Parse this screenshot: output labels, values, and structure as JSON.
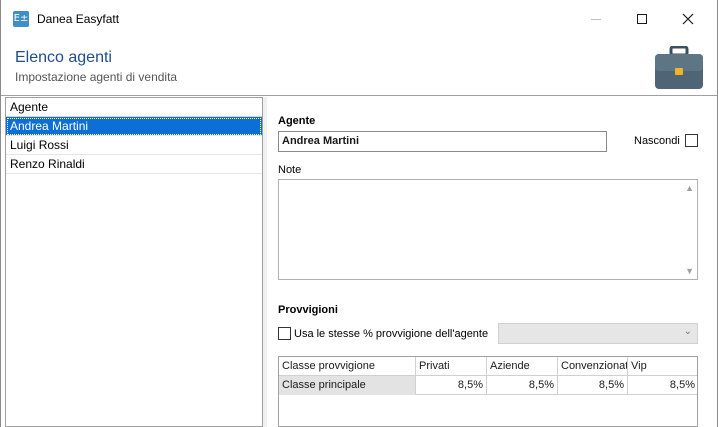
{
  "window": {
    "app_icon_text": "E±",
    "title": "Danea Easyfatt"
  },
  "header": {
    "title": "Elenco agenti",
    "subtitle": "Impostazione agenti di vendita",
    "icon": "briefcase-icon"
  },
  "agent_list": {
    "column_header": "Agente",
    "items": [
      {
        "label": "Andrea Martini",
        "selected": true
      },
      {
        "label": "Luigi Rossi",
        "selected": false
      },
      {
        "label": "Renzo Rinaldi",
        "selected": false
      }
    ]
  },
  "form": {
    "agent_label": "Agente",
    "agent_value": "Andrea Martini",
    "hide_label": "Nascondi",
    "hide_checked": false,
    "notes_label": "Note",
    "notes_value": "",
    "commissions_label": "Provvigioni",
    "same_commission_label": "Usa le stesse % provvigione dell'agente",
    "same_commission_checked": false,
    "same_commission_agent": ""
  },
  "commission_grid": {
    "columns": [
      "Classe provvigione",
      "Privati",
      "Aziende",
      "Convenzionati",
      "Vip"
    ],
    "rows": [
      [
        "Classe principale",
        "8,5%",
        "8,5%",
        "8,5%",
        "8,5%"
      ]
    ]
  },
  "colors": {
    "selection": "#0b6fd6",
    "header_title": "#1f4e8c",
    "app_icon": "#3d8fc6"
  }
}
